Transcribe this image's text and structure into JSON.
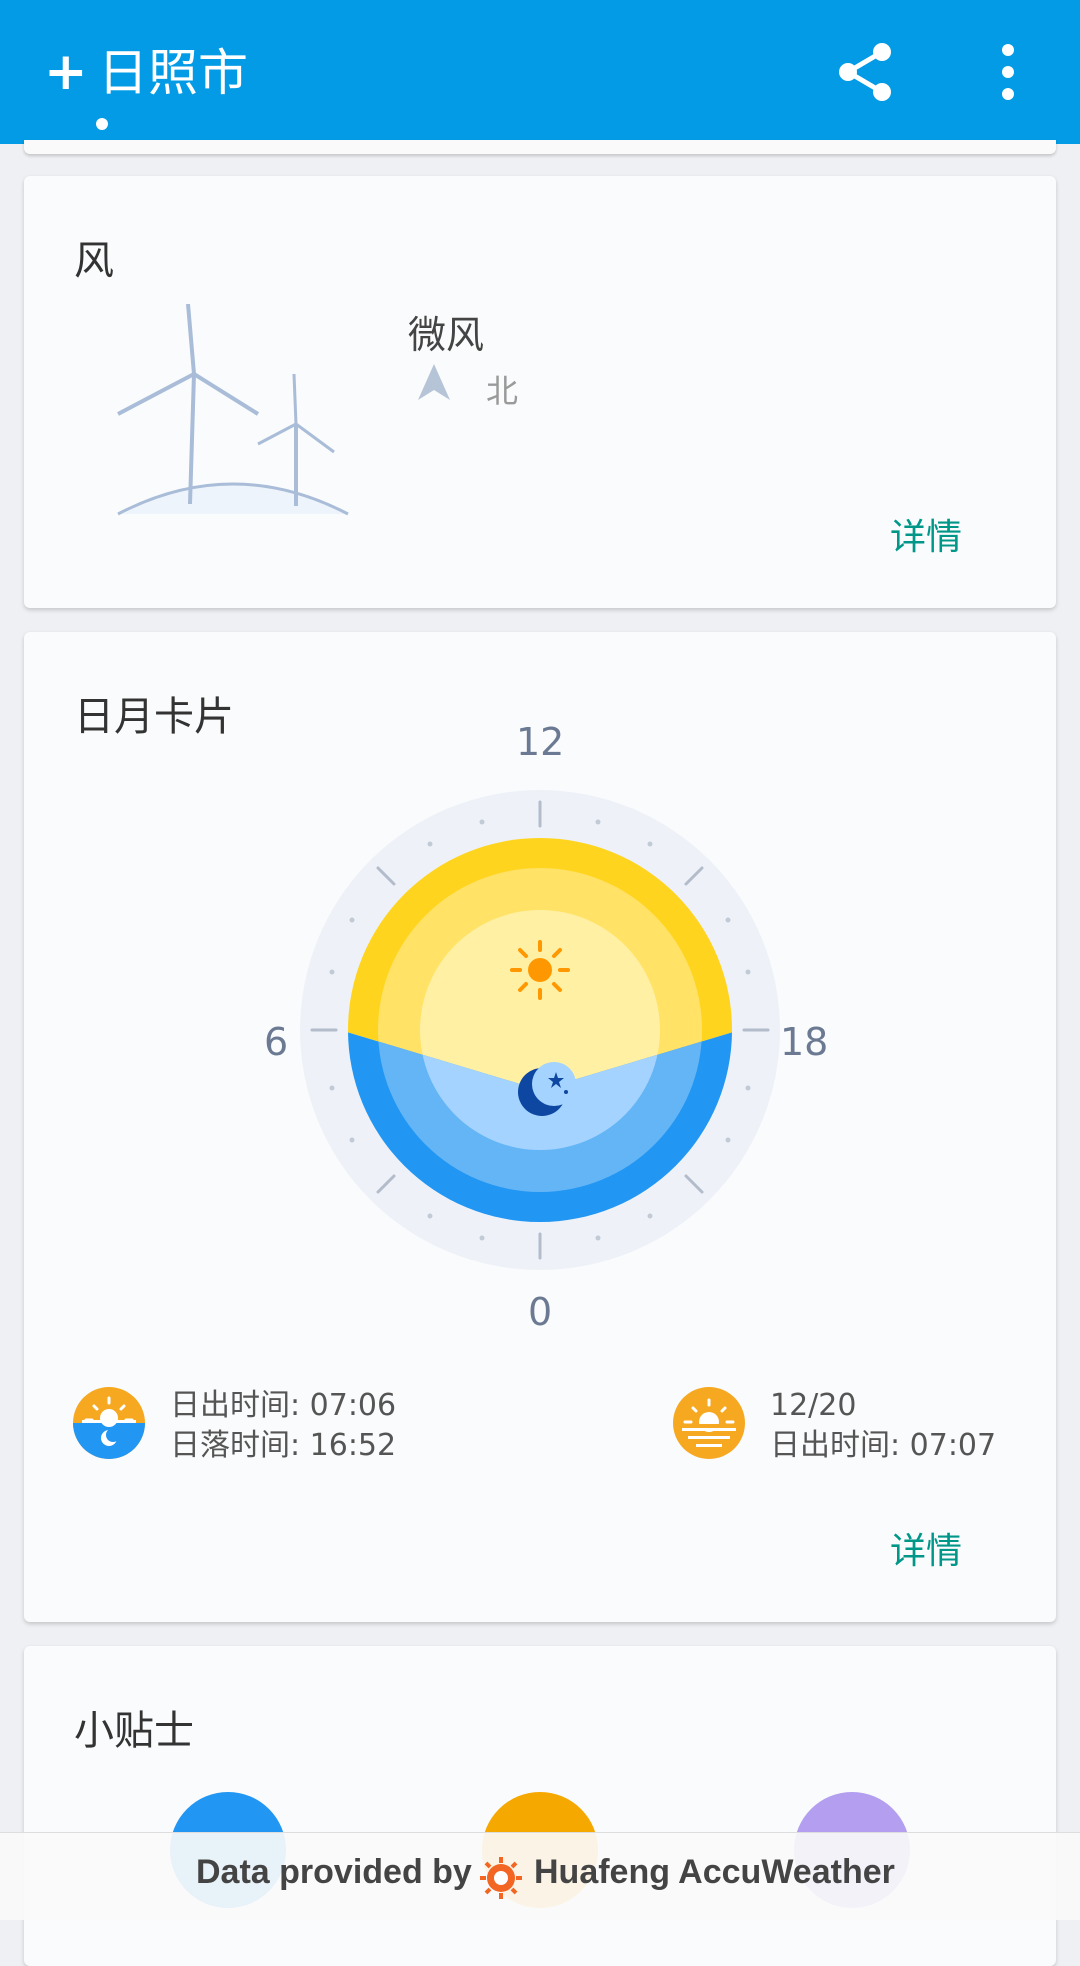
{
  "header": {
    "add_label": "+",
    "city": "日照市",
    "share_icon": "share-icon",
    "more_icon": "more-vert-icon",
    "background": "#039be5"
  },
  "wind": {
    "title": "风",
    "level": "微风",
    "direction": "北",
    "detail": "详情",
    "illustration_icon": "wind-turbine-icon"
  },
  "sun_moon": {
    "title": "日月卡片",
    "dial": {
      "top": "12",
      "left": "6",
      "right": "18",
      "bottom": "0"
    },
    "today": {
      "sunrise": "日出时间: 07:06",
      "sunset": "日落时间: 16:52"
    },
    "next": {
      "date": "12/20",
      "sunrise": "日出时间: 07:07"
    },
    "detail": "详情",
    "colors": {
      "day": "#ffd54f",
      "night": "#42a5f5",
      "accent": "#009688"
    }
  },
  "tips": {
    "title": "小贴士",
    "icons": [
      "car-wash-icon",
      "sport-icon",
      "uv-icon"
    ]
  },
  "footer": {
    "text": "Data provided by",
    "brand": "Huafeng AccuWeather"
  }
}
